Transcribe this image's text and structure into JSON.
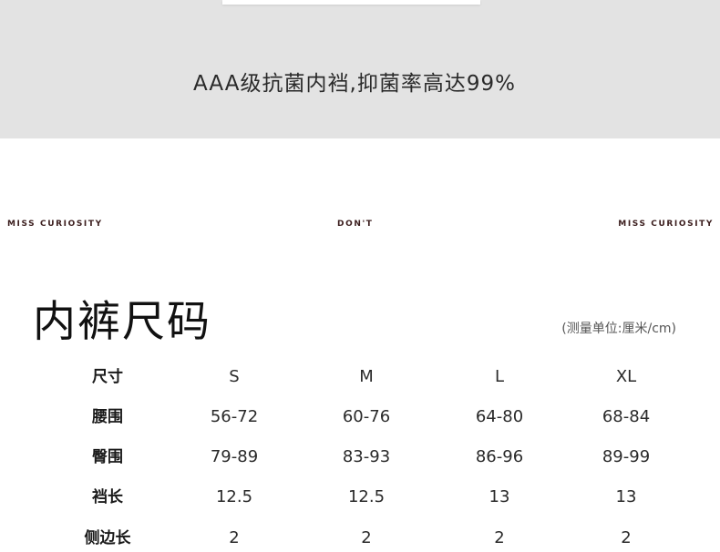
{
  "banner": {
    "caption": "AAA级抗菌内裆,抑菌率高达99%"
  },
  "brand_row": {
    "left": "MISS CURIOSITY",
    "center": "DON'T",
    "right": "MISS CURIOSITY"
  },
  "title": "内裤尺码",
  "unit_note": "(测量单位:厘米/cm)",
  "size_table": {
    "header": {
      "label": "尺寸",
      "values": [
        "S",
        "M",
        "L",
        "XL"
      ]
    },
    "rows": [
      {
        "label": "腰围",
        "values": [
          "56-72",
          "60-76",
          "64-80",
          "68-84"
        ]
      },
      {
        "label": "臀围",
        "values": [
          "79-89",
          "83-93",
          "86-96",
          "89-99"
        ]
      },
      {
        "label": "裆长",
        "values": [
          "12.5",
          "12.5",
          "13",
          "13"
        ]
      },
      {
        "label": "侧边长",
        "values": [
          "2",
          "2",
          "2",
          "2"
        ]
      }
    ]
  },
  "colors": {
    "banner_bg": "#e3e3e3",
    "brand_text": "#3a1c1c",
    "text": "#1a1a1a"
  }
}
